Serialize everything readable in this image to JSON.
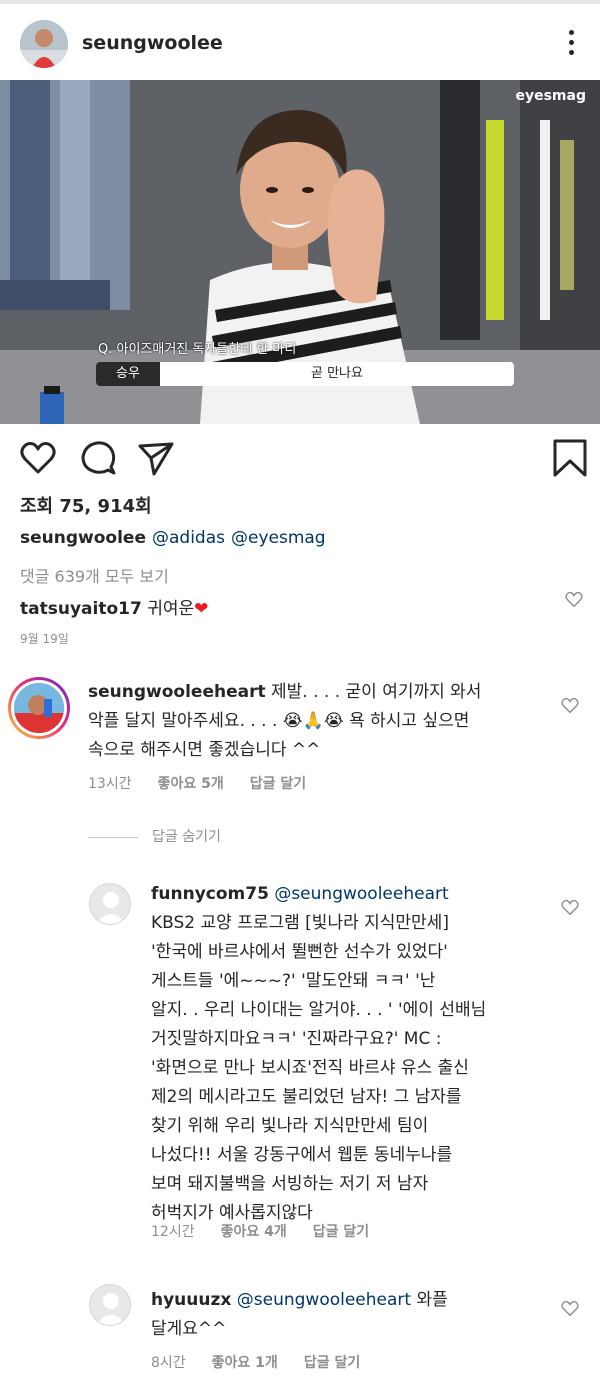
{
  "post": {
    "username": "seungwoolee",
    "watermark": "eyesmag",
    "subtitle_question": "Q. 아이즈매거진 독자들한테 한 마디",
    "subtitle_name": "승우",
    "subtitle_line": "곧 만나요",
    "views": "조회 75, 914회",
    "caption_user": "seungwoolee",
    "caption_tags": [
      "@adidas",
      "@eyesmag"
    ],
    "view_all_comments": "댓글 639개 모두 보기",
    "top_comment_user": "tatsuyaito17",
    "top_comment_text": "귀여운",
    "top_comment_emoji": "❤",
    "date": "9월 19일"
  },
  "comments": [
    {
      "user": "seungwooleeheart",
      "text_lines": [
        "제발. . . . 굳이 여기까지 와서",
        "악플 달지 말아주세요. . . . 😭🙏😭 욕 하시고 싶으면",
        "속으로 해주시면 좋겠습니다 ^^"
      ],
      "time": "13시간",
      "likes": "좋아요 5개",
      "reply": "답글 달기"
    }
  ],
  "hide_replies": "답글 숨기기",
  "replies": [
    {
      "user": "funnycom75",
      "mention": "@seungwooleeheart",
      "text_lines": [
        "KBS2 교양 프로그램 [빛나라 지식만만세]",
        "'한국에 바르샤에서 뛸뻔한 선수가 있었다'",
        "게스트들 '에~~~?' '말도안돼 ㅋㅋ' '난",
        "알지. . 우리 나이대는 알거야. . . ' '에이 선배님",
        "거짓말하지마요ㅋㅋ' '진짜라구요?' MC :",
        "'화면으로 만나 보시죠'전직 바르샤 유스 출신",
        "제2의 메시라고도 불리었던 남자! 그 남자를",
        "찾기 위해 우리 빛나라 지식만만세 팀이",
        "나섰다!! 서울 강동구에서 웹툰 동네누나를",
        "보며 돼지불백을 서빙하는 저기 저 남자",
        "허벅지가 예사롭지않다"
      ],
      "time": "12시간",
      "likes": "좋아요 4개",
      "reply": "답글 달기"
    },
    {
      "user": "hyuuuzx",
      "mention": "@seungwooleeheart",
      "text_first": "와플",
      "text_lines": [
        "달게요^^"
      ],
      "time": "8시간",
      "likes": "좋아요 1개",
      "reply": "답글 달기"
    }
  ],
  "colors": {
    "text": "#262626",
    "muted": "#8e8e8e",
    "mention": "#003569",
    "heart": "#ed1c24"
  },
  "icons": [
    "more-icon",
    "heart-icon",
    "comment-icon",
    "share-icon",
    "bookmark-icon",
    "small-heart-icon"
  ]
}
